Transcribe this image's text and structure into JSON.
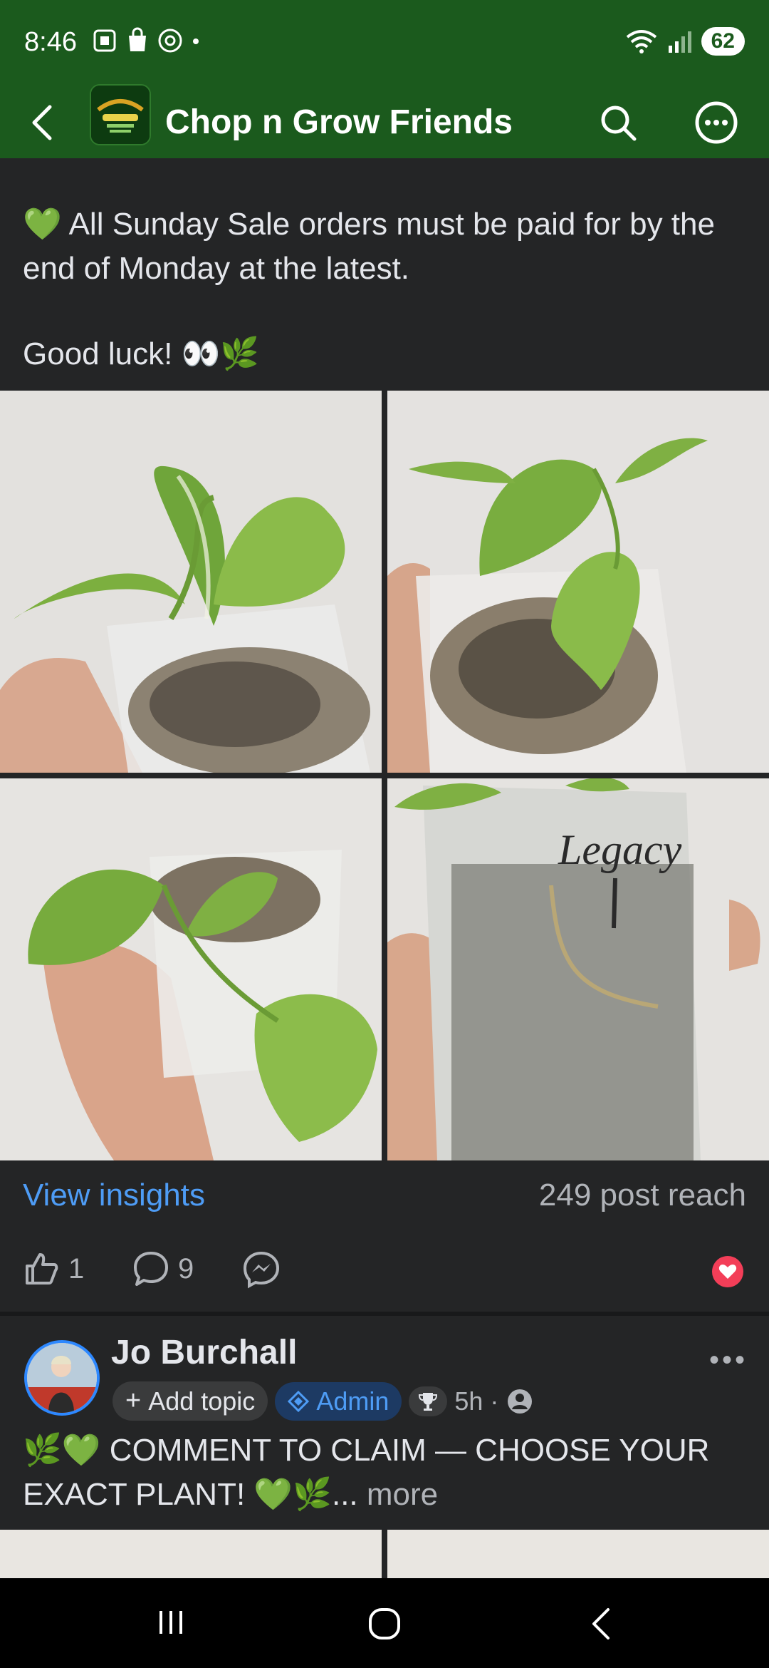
{
  "status": {
    "time": "8:46",
    "battery": "62",
    "icons": [
      "screenshot-icon",
      "shop-icon",
      "threads-icon",
      "wifi-icon",
      "signal-icon"
    ]
  },
  "appbar": {
    "title": "Chop n Grow Friends"
  },
  "post": {
    "line1": "💚 All Sunday Sale orders must be paid for by the end of Monday at the latest.",
    "line2": "Good luck! 👀🌿",
    "insights_label": "View insights",
    "reach": "249 post reach",
    "likes": "1",
    "comments": "9",
    "photo_label": "Legacy 1"
  },
  "post2": {
    "author": "Jo Burchall",
    "add_topic": "Add topic",
    "role": "Admin",
    "time": "5h",
    "text": "🌿💚 COMMENT TO CLAIM — CHOOSE YOUR EXACT PLANT! 💚🌿...",
    "more": "more"
  },
  "colors": {
    "header_green": "#1b5a1d",
    "background": "#242526",
    "link_blue": "#4e9cf5",
    "heart_red": "#f33e58"
  }
}
